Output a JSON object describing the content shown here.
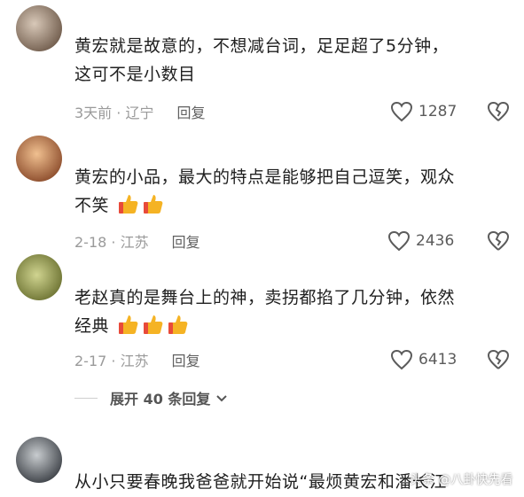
{
  "comments": [
    {
      "text_lines": [
        "黄宏就是故意的，不想减台词，足足超了5分钟，",
        "这可不是小数目"
      ],
      "date": "3天前 · 辽宁",
      "reply_label": "回复",
      "likes": "1287",
      "avatar_colors": [
        "#c8b8a8",
        "#6e5a4a"
      ]
    },
    {
      "text_lines": [
        "黄宏的小品，最大的特点是能够把自己逗笑，观众",
        "不笑"
      ],
      "date": "2-18 · 江苏",
      "reply_label": "回复",
      "likes": "2436",
      "avatar_colors": [
        "#d9a070",
        "#8a4a2a"
      ],
      "emoji_count": 2
    },
    {
      "text_lines": [
        "老赵真的是舞台上的神，卖拐都掐了几分钟，依然",
        "经典"
      ],
      "date": "2-17 · 江苏",
      "reply_label": "回复",
      "likes": "6413",
      "avatar_colors": [
        "#b4b87a",
        "#6a7030"
      ],
      "emoji_count": 3
    }
  ],
  "expand_label": "展开 40 条回复",
  "partial_comment": {
    "text": "从小只要春晚我爸爸就开始说“最烦黄宏和潘长江",
    "avatar_colors": [
      "#9aa0a4",
      "#3a3e44"
    ]
  },
  "watermark": "头条 @八卦快先看",
  "colors": {
    "emoji": "#f5b324",
    "emoji_cuff": "#e84a3a"
  },
  "icons": [
    "heart-icon",
    "broken-heart-icon",
    "chevron-down-icon",
    "thumbs-up-emoji"
  ]
}
